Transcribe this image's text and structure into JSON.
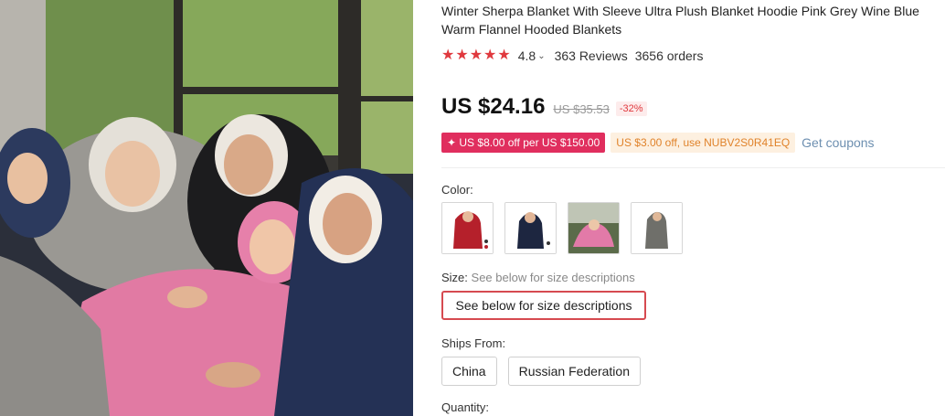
{
  "product": {
    "title": "Winter Sherpa Blanket With Sleeve Ultra Plush Blanket Hoodie Pink Grey Wine Blue Warm Flannel Hooded Blankets",
    "rating": {
      "stars": 5,
      "value": "4.8",
      "chevron": "⌄",
      "reviews": "363 Reviews",
      "orders": "3656 orders",
      "star_color": "#e0393e"
    },
    "price": {
      "current": "US $24.16",
      "original": "US $35.53",
      "discount": "-32%"
    },
    "coupons": {
      "store_coupon": "✦ US $8.00 off per US $150.00",
      "code_coupon": "US $3.00 off, use NUBV2S0R41EQ",
      "get_coupons": "Get coupons",
      "store_color": "#e02e5e",
      "code_color": "#e0832b"
    },
    "color": {
      "label": "Color:",
      "options": [
        {
          "name": "wine",
          "color": "#b5202b"
        },
        {
          "name": "navy blue",
          "color": "#1d2640"
        },
        {
          "name": "pink",
          "color": "#e27aa8"
        },
        {
          "name": "grey",
          "color": "#6f6f6a"
        }
      ]
    },
    "size": {
      "label": "Size:",
      "hint": "See below for size descriptions",
      "selected": "See below for size descriptions"
    },
    "ships_from": {
      "label": "Ships From:",
      "options": [
        "China",
        "Russian Federation"
      ]
    },
    "quantity": {
      "label": "Quantity:"
    }
  }
}
